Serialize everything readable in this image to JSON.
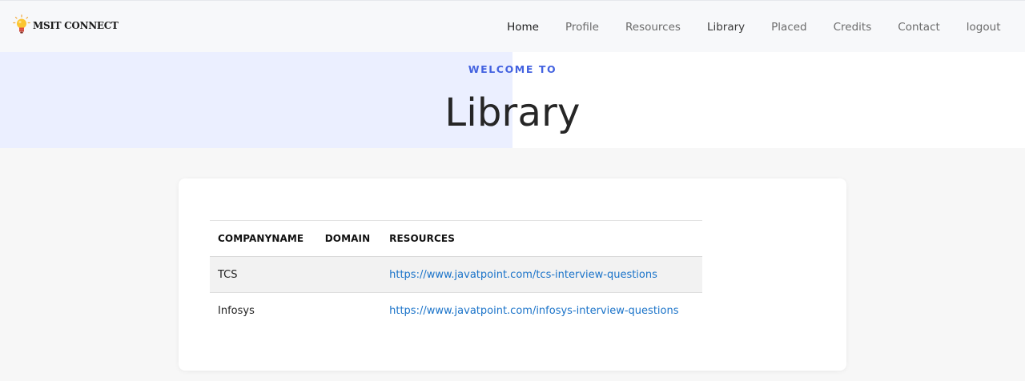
{
  "brand": {
    "name": "MSIT CONNECT",
    "logo_icon": "lightbulb-icon"
  },
  "nav": {
    "items": [
      {
        "label": "Home"
      },
      {
        "label": "Profile"
      },
      {
        "label": "Resources"
      },
      {
        "label": "Library"
      },
      {
        "label": "Placed"
      },
      {
        "label": "Credits"
      },
      {
        "label": "Contact"
      },
      {
        "label": "logout"
      }
    ]
  },
  "hero": {
    "subtitle": "WELCOME TO",
    "title": "Library"
  },
  "table": {
    "headers": [
      "COMPANYNAME",
      "DOMAIN",
      "RESOURCES"
    ],
    "rows": [
      {
        "company": "TCS",
        "domain": "",
        "resource": "https://www.javatpoint.com/tcs-interview-questions"
      },
      {
        "company": "Infosys",
        "domain": "",
        "resource": "https://www.javatpoint.com/infosys-interview-questions"
      }
    ]
  },
  "colors": {
    "accent": "#4362e0",
    "hero_tint": "#ebefff",
    "link": "#1a73c9",
    "page_bg": "#f7f7f7",
    "navbar_bg": "#f7f8fa"
  }
}
